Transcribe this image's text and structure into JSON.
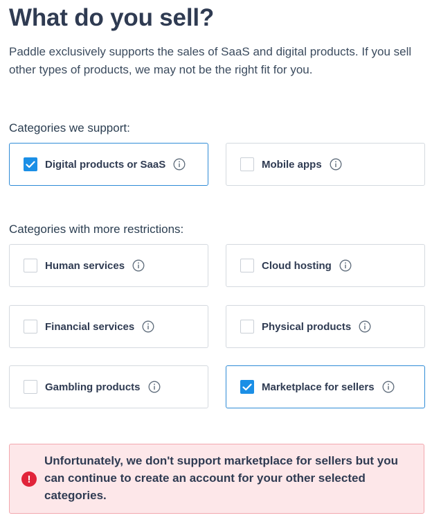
{
  "page": {
    "title": "What do you sell?",
    "intro": "Paddle exclusively supports the sales of SaaS and digital products. If you sell other types of products, we may not be the right fit for you."
  },
  "supported": {
    "label": "Categories we support:",
    "items": [
      {
        "label": "Digital products or SaaS",
        "checked": true
      },
      {
        "label": "Mobile apps",
        "checked": false
      }
    ]
  },
  "restricted": {
    "label": "Categories with more restrictions:",
    "items": [
      {
        "label": "Human services",
        "checked": false
      },
      {
        "label": "Cloud hosting",
        "checked": false
      },
      {
        "label": "Financial services",
        "checked": false
      },
      {
        "label": "Physical products",
        "checked": false
      },
      {
        "label": "Gambling products",
        "checked": false
      },
      {
        "label": "Marketplace for sellers",
        "checked": true
      }
    ]
  },
  "alert": {
    "icon": "!",
    "message": "Unfortunately, we don't support marketplace for sellers but you can continue to create an account for your other selected categories."
  },
  "colors": {
    "accent": "#1b8fe6",
    "selected_border": "#2e8bd6",
    "error_bg": "#fde7e9",
    "error_icon": "#e1243a"
  }
}
